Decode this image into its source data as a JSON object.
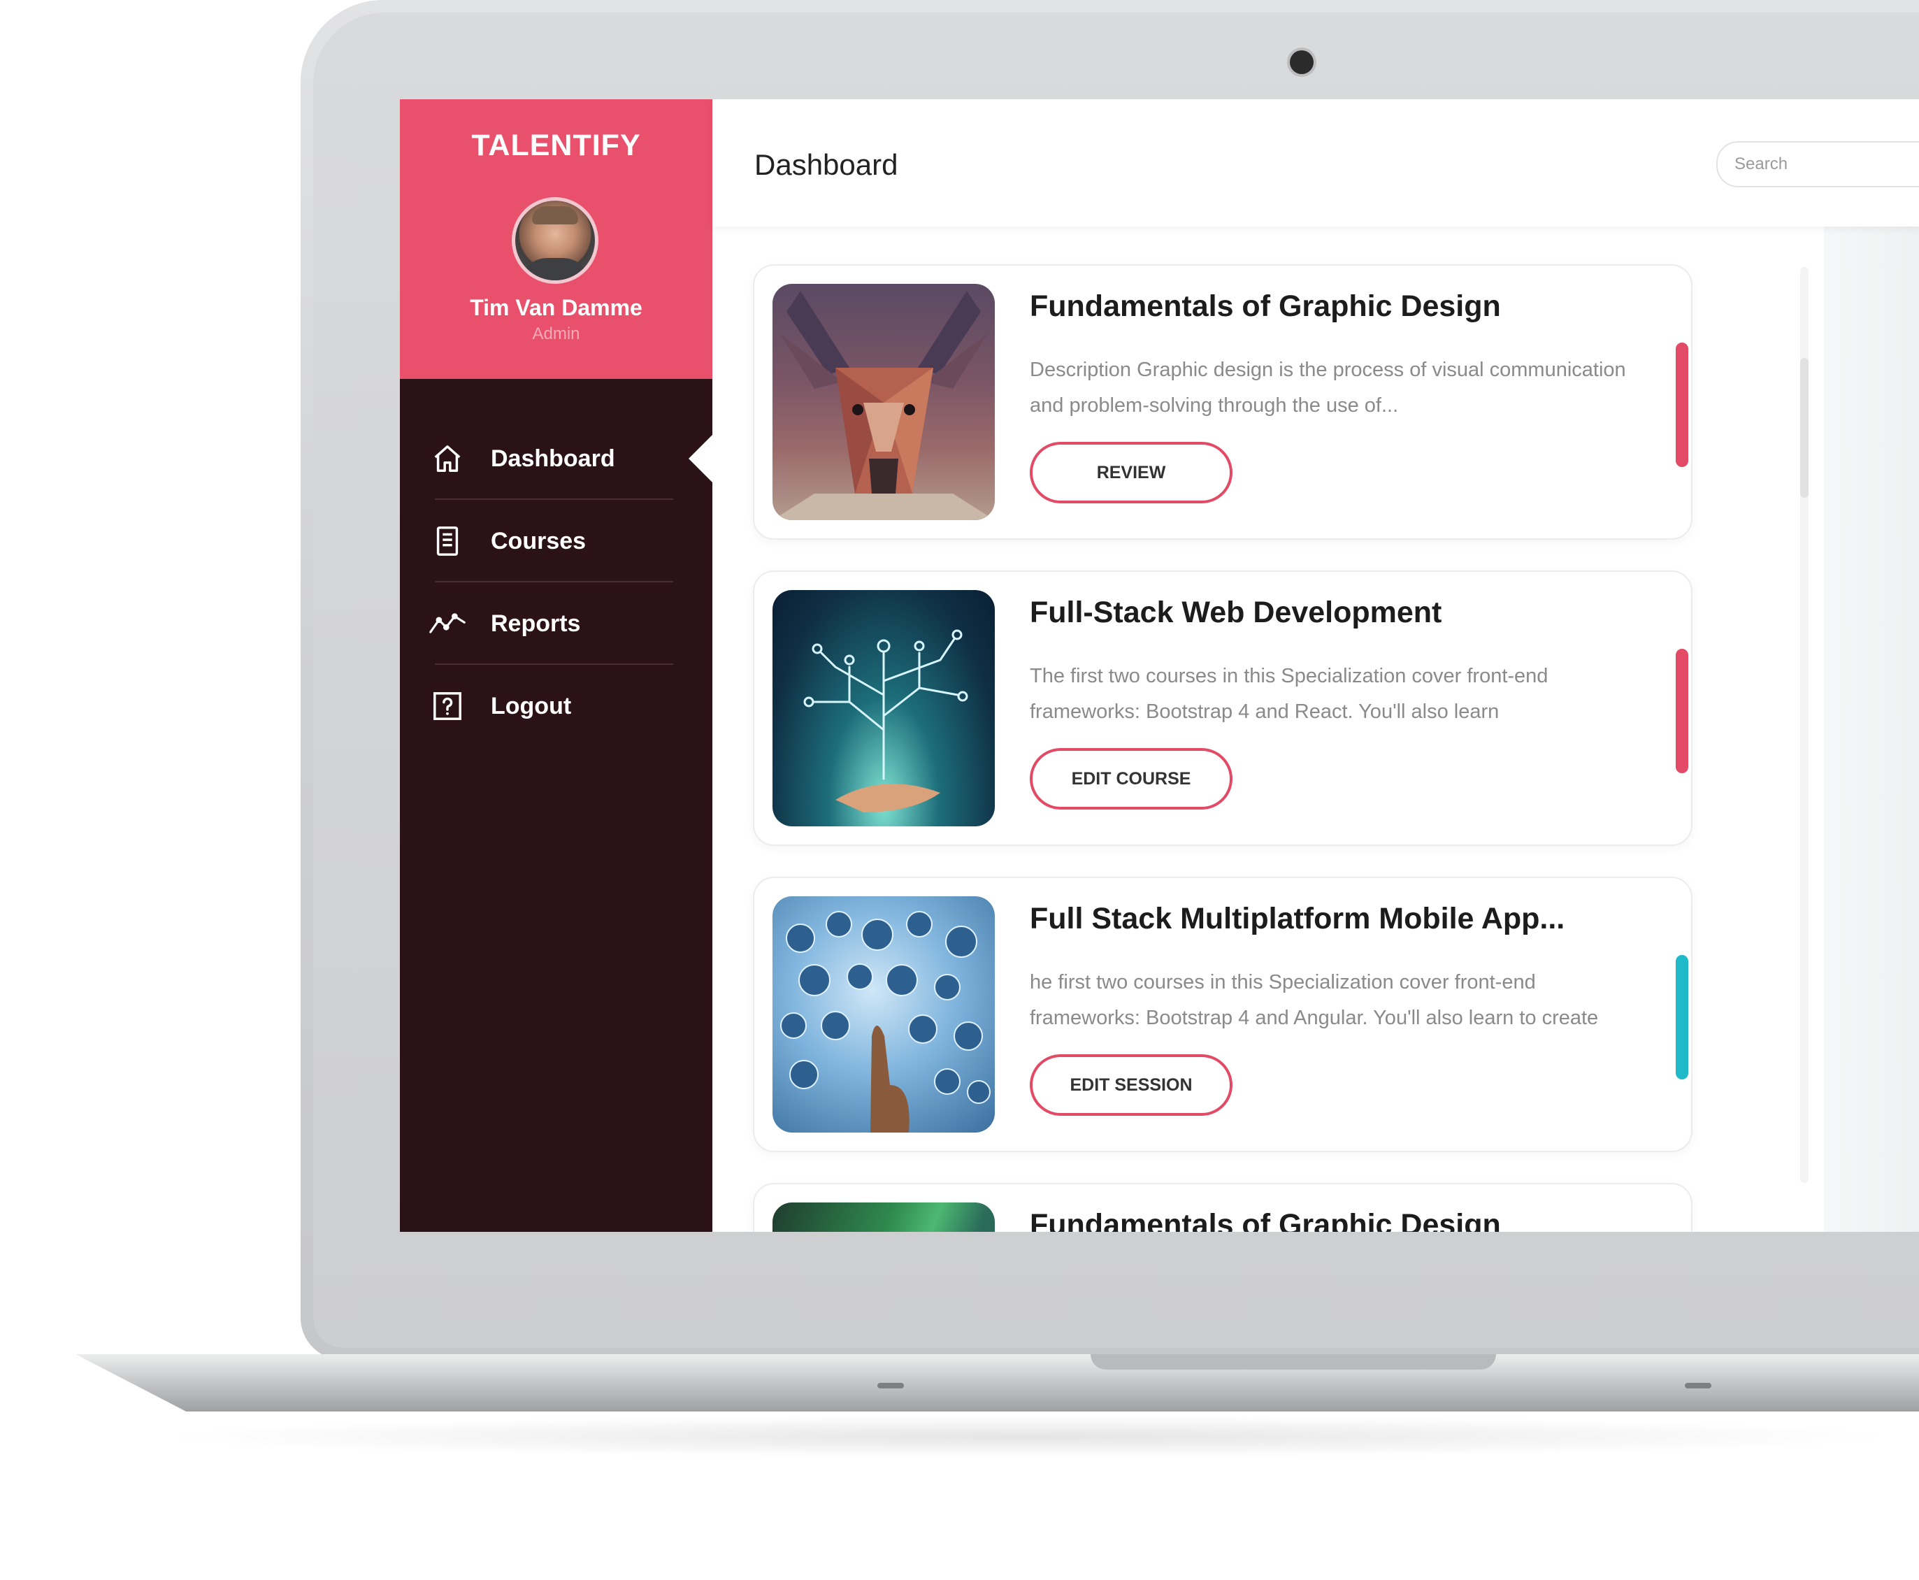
{
  "app": {
    "brand": "TALENTIFY"
  },
  "user": {
    "name": "Tim Van Damme",
    "role": "Admin"
  },
  "nav": {
    "items": [
      {
        "label": "Dashboard",
        "icon": "home-icon",
        "active": true
      },
      {
        "label": "Courses",
        "icon": "document-icon",
        "active": false
      },
      {
        "label": "Reports",
        "icon": "line-chart-icon",
        "active": false
      },
      {
        "label": "Logout",
        "icon": "question-box-icon",
        "active": false
      }
    ]
  },
  "header": {
    "title": "Dashboard",
    "search_placeholder": "Search"
  },
  "courses": [
    {
      "title": "Fundamentals of Graphic Design",
      "description": "Description Graphic design is the process of visual communication and problem-solving through the use of...",
      "button": "REVIEW",
      "accent": "#e24a66",
      "thumbnail": "low-poly-deer-image"
    },
    {
      "title": "Full-Stack Web Development",
      "description": "The first two courses in this Specialization cover front-end frameworks: Bootstrap 4 and React. You'll also learn",
      "button": "EDIT COURSE",
      "accent": "#e24a66",
      "thumbnail": "circuit-tree-hand-image"
    },
    {
      "title": "Full Stack Multiplatform Mobile App...",
      "description": "he first two courses in this Specialization cover front-end frameworks: Bootstrap 4 and Angular. You'll also learn to create",
      "button": "EDIT SESSION",
      "accent": "#1fb9c9",
      "thumbnail": "app-icons-finger-image"
    },
    {
      "title": "Fundamentals of Graphic Design",
      "description": "",
      "button": "",
      "accent": "#e24a66",
      "thumbnail": "green-abstract-image"
    }
  ],
  "colors": {
    "brand_pink": "#e9506c",
    "sidebar_dark": "#2a1217",
    "button_border": "#e24a66",
    "teal_accent": "#1fb9c9"
  }
}
